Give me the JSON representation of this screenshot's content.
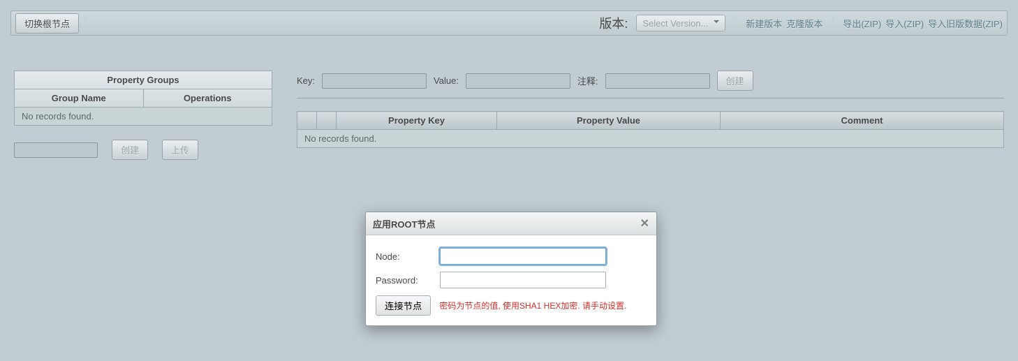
{
  "toolbar": {
    "switch_root": "切换根节点",
    "version_label": "版本:",
    "select_version_placeholder": "Select Version...",
    "links": {
      "new_version": "新建版本",
      "clone_version": "克隆版本",
      "export_zip": "导出(ZIP)",
      "import_zip": "导入(ZIP)",
      "import_legacy": "导入旧版数据(ZIP)"
    }
  },
  "left": {
    "title": "Property Groups",
    "col_group": "Group Name",
    "col_ops": "Operations",
    "no_records": "No records found.",
    "create_btn": "创建",
    "upload_btn": "上传"
  },
  "right": {
    "key_label": "Key:",
    "value_label": "Value:",
    "comment_label": "注释:",
    "create_btn": "创建",
    "table": {
      "col_key": "Property Key",
      "col_value": "Property Value",
      "col_comment": "Comment",
      "no_records": "No records found."
    }
  },
  "dialog": {
    "title": "应用ROOT节点",
    "node_label": "Node:",
    "password_label": "Password:",
    "connect_btn": "连接节点",
    "hint": "密码为节点的值, 使用SHA1 HEX加密. 请手动设置."
  }
}
